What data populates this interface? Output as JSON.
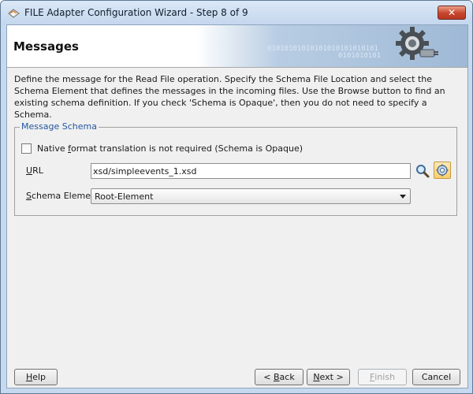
{
  "window": {
    "title": "FILE Adapter Configuration Wizard - Step 8 of 9",
    "close_label": "✕"
  },
  "banner": {
    "title": "Messages",
    "binary_1": "01010101010101010101010101",
    "binary_2": "0101010101"
  },
  "description": "Define the message for the Read File operation.  Specify the Schema File Location and select the Schema Element that defines the messages in the incoming files. Use the Browse button to find an existing schema definition. If you check 'Schema is Opaque', then you do not need to specify a Schema.",
  "message_schema": {
    "legend": "Message Schema",
    "opaque_checkbox": {
      "label_before": "Native ",
      "label_mnemonic": "f",
      "label_after": "ormat translation is not required (Schema is Opaque)",
      "checked": false
    },
    "url": {
      "label_mnemonic": "U",
      "label_after": "RL",
      "value": "xsd/simpleevents_1.xsd"
    },
    "schema_element": {
      "label_mnemonic": "S",
      "label_after": "chema Element",
      "selected": "Root-Element"
    }
  },
  "buttons": {
    "help": {
      "mnemonic": "H",
      "rest": "elp"
    },
    "back": {
      "prefix": "< ",
      "mnemonic": "B",
      "rest": "ack"
    },
    "next": {
      "mnemonic": "N",
      "rest": "ext >"
    },
    "finish": {
      "mnemonic": "F",
      "rest": "inish",
      "enabled": false
    },
    "cancel": {
      "label": "Cancel"
    }
  },
  "icons": {
    "app": "adapter-wizard-icon",
    "banner": "gear-plug-icon",
    "search": "search-icon",
    "browse": "browse-schema-icon"
  }
}
